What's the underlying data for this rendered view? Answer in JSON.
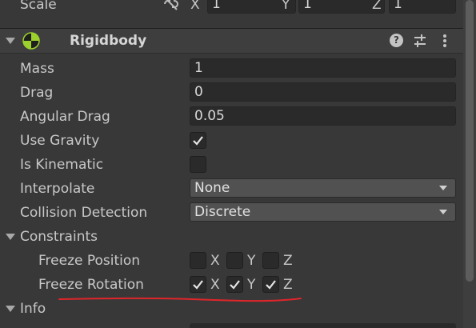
{
  "transform": {
    "scale_label": "Scale",
    "x_label": "X",
    "x_value": "1",
    "y_label": "Y",
    "y_value": "1",
    "z_label": "Z",
    "z_value": "1"
  },
  "rigidbody": {
    "title": "Rigidbody",
    "mass_label": "Mass",
    "mass_value": "1",
    "drag_label": "Drag",
    "drag_value": "0",
    "angular_drag_label": "Angular Drag",
    "angular_drag_value": "0.05",
    "use_gravity_label": "Use Gravity",
    "use_gravity_checked": true,
    "is_kinematic_label": "Is Kinematic",
    "is_kinematic_checked": false,
    "interpolate_label": "Interpolate",
    "interpolate_value": "None",
    "collision_label": "Collision Detection",
    "collision_value": "Discrete",
    "constraints_label": "Constraints",
    "freeze_position_label": "Freeze Position",
    "freeze_rotation_label": "Freeze Rotation",
    "axis_x": "X",
    "axis_y": "Y",
    "axis_z": "Z",
    "freeze_position": [
      false,
      false,
      false
    ],
    "freeze_rotation": [
      true,
      true,
      true
    ],
    "info_label": "Info"
  },
  "colors": {
    "background": "#383838",
    "annotation": "#e0252a"
  }
}
